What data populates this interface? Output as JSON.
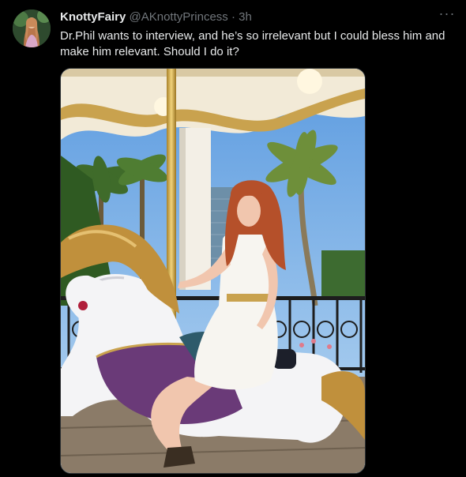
{
  "tweet": {
    "display_name": "KnottyFairy",
    "handle": "@AKnottyPrincess",
    "separator": "·",
    "time": "3h",
    "more_glyph": "···",
    "text": "Dr.Phil wants to interview, and he’s so irrelevant but I could bless him and make him relevant. Should I do it?"
  },
  "colors": {
    "background": "#000000",
    "primary_text": "#e7e9ea",
    "secondary_text": "#71767b",
    "border": "#2f3336"
  },
  "icons": {
    "more": "more-horizontal-icon"
  }
}
